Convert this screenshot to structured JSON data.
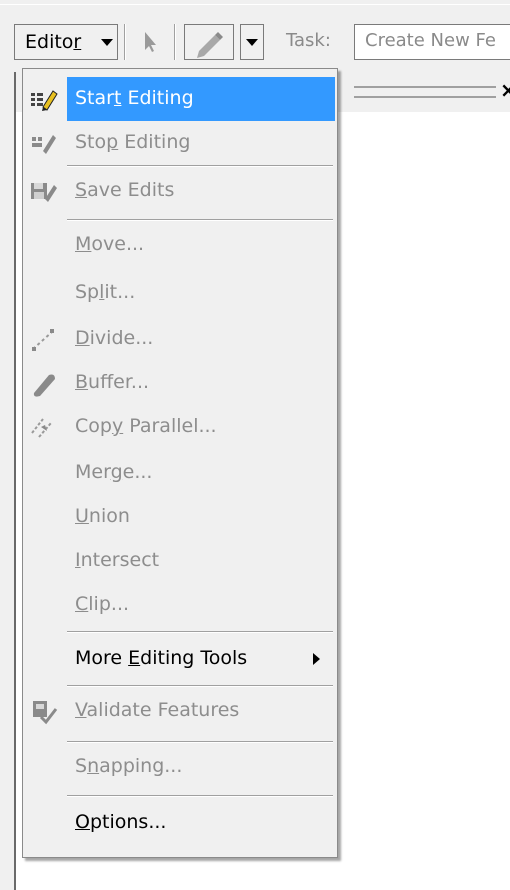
{
  "toolbar": {
    "editor_label_pre": "Edito",
    "editor_label_ul": "r",
    "task_label": "Task:",
    "task_value": "Create New Fe"
  },
  "menu": {
    "items": [
      {
        "pre": "Star",
        "ul": "t",
        "post": " Editing",
        "icon": "start-editing-icon",
        "state": "highlighted"
      },
      {
        "pre": "Sto",
        "ul": "p",
        "post": " Editing",
        "icon": "stop-editing-icon",
        "state": "disabled"
      },
      {
        "pre": "",
        "ul": "S",
        "post": "ave Edits",
        "icon": "save-edits-icon",
        "state": "disabled"
      },
      {
        "pre": "",
        "ul": "M",
        "post": "ove...",
        "icon": "",
        "state": "disabled"
      },
      {
        "pre": "Sp",
        "ul": "l",
        "post": "it...",
        "icon": "",
        "state": "disabled"
      },
      {
        "pre": "",
        "ul": "D",
        "post": "ivide...",
        "icon": "divide-icon",
        "state": "disabled"
      },
      {
        "pre": "",
        "ul": "B",
        "post": "uffer...",
        "icon": "buffer-icon",
        "state": "disabled"
      },
      {
        "pre": "Cop",
        "ul": "y",
        "post": " Parallel...",
        "icon": "copy-parallel-icon",
        "state": "disabled"
      },
      {
        "pre": "Mer",
        "ul": "g",
        "post": "e...",
        "icon": "",
        "state": "disabled"
      },
      {
        "pre": "",
        "ul": "U",
        "post": "nion",
        "icon": "",
        "state": "disabled"
      },
      {
        "pre": "",
        "ul": "I",
        "post": "ntersect",
        "icon": "",
        "state": "disabled"
      },
      {
        "pre": "",
        "ul": "C",
        "post": "lip...",
        "icon": "",
        "state": "disabled"
      },
      {
        "pre": "More ",
        "ul": "E",
        "post": "diting Tools",
        "icon": "",
        "state": "enabled",
        "submenu": true
      },
      {
        "pre": "",
        "ul": "V",
        "post": "alidate Features",
        "icon": "validate-features-icon",
        "state": "disabled"
      },
      {
        "pre": "S",
        "ul": "n",
        "post": "apping...",
        "icon": "",
        "state": "disabled"
      },
      {
        "pre": "",
        "ul": "O",
        "post": "ptions...",
        "icon": "",
        "state": "enabled"
      }
    ]
  },
  "colors": {
    "highlight": "#3399ff",
    "disabled_text": "#8d8d8d",
    "menu_background": "#f0f0f0"
  }
}
